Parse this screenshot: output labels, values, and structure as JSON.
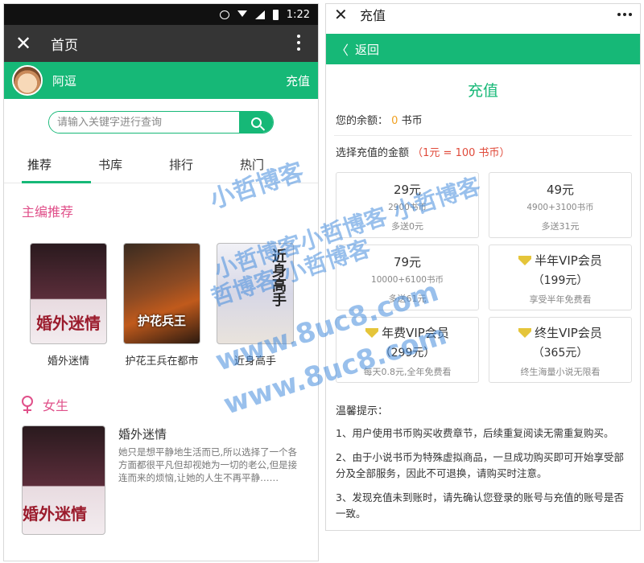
{
  "left": {
    "status": {
      "time": "1:22"
    },
    "titlebar": {
      "close": "✕",
      "title": "首页"
    },
    "user": {
      "name": "阿逗",
      "recharge": "充值"
    },
    "search": {
      "placeholder": "请输入关键字进行查询"
    },
    "tabs": [
      "推荐",
      "书库",
      "排行",
      "热门"
    ],
    "editor_section": "主编推荐",
    "books": [
      {
        "cover_text": "婚外迷情",
        "title": "婚外迷情"
      },
      {
        "cover_text": "护花兵王",
        "title": "护花王兵在都市"
      },
      {
        "cover_text": "近身高手",
        "title": "近身高手"
      }
    ],
    "female_section": "女生",
    "featured": {
      "cover_text": "婚外迷情",
      "title": "婚外迷情",
      "desc": "她只是想平静地生活而已,所以选择了一个各方面都很平凡但却视她为一切的老公,但是接连而来的烦恼,让她的人生不再平静……"
    }
  },
  "right": {
    "titlebar": {
      "close": "✕",
      "title": "充值"
    },
    "back": "返回",
    "page_title": "充值",
    "balance": {
      "prefix": "您的余额：",
      "value": "0",
      "unit": "书币"
    },
    "choose": {
      "label": "选择充值的金额",
      "rate": "（1元 = 100 书币）"
    },
    "options": [
      {
        "price": "29元",
        "detail": "2900书币",
        "extra": "多送0元",
        "vip": false
      },
      {
        "price": "49元",
        "detail": "4900+3100书币",
        "extra": "多送31元",
        "vip": false
      },
      {
        "price": "79元",
        "detail": "10000+6100书币",
        "extra": "多送61元",
        "vip": false
      },
      {
        "price": "半年VIP会员",
        "sub": "（199元）",
        "extra": "享受半年免费看",
        "vip": true
      },
      {
        "price": "年费VIP会员",
        "sub": "（299元）",
        "extra": "每天0.8元,全年免费看",
        "vip": true
      },
      {
        "price": "终生VIP会员",
        "sub": "（365元）",
        "extra": "终生海量小说无限看",
        "vip": true
      }
    ],
    "tips_title": "温馨提示：",
    "tips": [
      "1、用户使用书币购买收费章节，后续重复阅读无需重复购买。",
      "2、由于小说书币为特殊虚拟商品，一旦成功购买即可开始享受部分及全部服务，因此不可退换，请购买时注意。",
      "3、发现充值未到账时，请先确认您登录的账号与充值的账号是否一致。"
    ]
  },
  "watermark": [
    "小哲博客",
    "小哲博客小哲博客 小哲博客",
    "哲博客 小哲博客",
    "www.8uc8.com",
    "www.8uc8.com"
  ],
  "colors": {
    "accent": "#16b877",
    "pink": "#e0508a",
    "coin": "#f0a020",
    "red": "#e04a3a"
  }
}
